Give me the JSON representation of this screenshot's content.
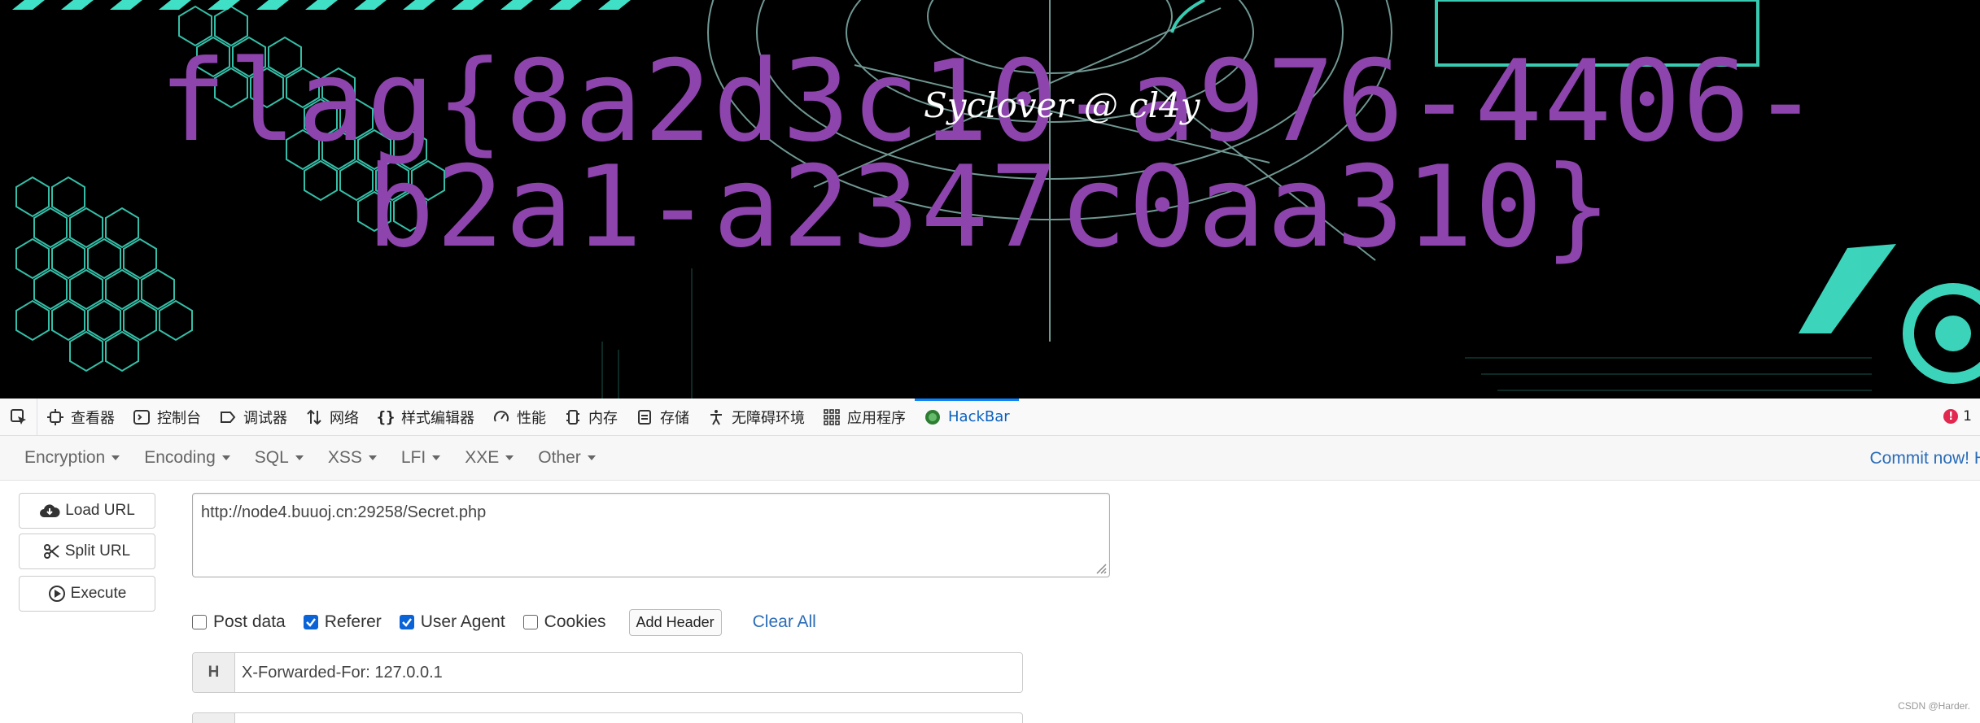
{
  "page": {
    "flag_text": "flag{8a2d3c10-a976-4406-b2a1-a2347c0aa310}",
    "signature": "Syclover @ cl4y",
    "colors": {
      "flag": "#8e44ad",
      "background": "#000000",
      "accent": "#3fe0c5"
    }
  },
  "devtools": {
    "tabs": [
      {
        "label": "查看器",
        "icon": "inspector-icon"
      },
      {
        "label": "控制台",
        "icon": "console-icon"
      },
      {
        "label": "调试器",
        "icon": "debugger-icon"
      },
      {
        "label": "网络",
        "icon": "network-icon"
      },
      {
        "label": "样式编辑器",
        "icon": "style-editor-icon"
      },
      {
        "label": "性能",
        "icon": "performance-icon"
      },
      {
        "label": "内存",
        "icon": "memory-icon"
      },
      {
        "label": "存储",
        "icon": "storage-icon"
      },
      {
        "label": "无障碍环境",
        "icon": "accessibility-icon"
      },
      {
        "label": "应用程序",
        "icon": "application-icon"
      },
      {
        "label": "HackBar",
        "icon": "hackbar-icon",
        "active": true
      }
    ],
    "error_count": "1"
  },
  "hackbar": {
    "menu": [
      "Encryption",
      "Encoding",
      "SQL",
      "XSS",
      "LFI",
      "XXE",
      "Other"
    ],
    "commit_link": "Commit now! H",
    "buttons": {
      "load_url": "Load URL",
      "split_url": "Split URL",
      "execute": "Execute"
    },
    "url": "http://node4.buuoj.cn:29258/Secret.php",
    "options": {
      "post_data": {
        "label": "Post data",
        "checked": false
      },
      "referer": {
        "label": "Referer",
        "checked": true
      },
      "user_agent": {
        "label": "User Agent",
        "checked": true
      },
      "cookies": {
        "label": "Cookies",
        "checked": false
      }
    },
    "add_header": "Add Header",
    "clear_all": "Clear All",
    "headers": [
      {
        "tag": "H",
        "value": "X-Forwarded-For: 127.0.0.1"
      }
    ]
  },
  "watermark": "CSDN @Harder."
}
